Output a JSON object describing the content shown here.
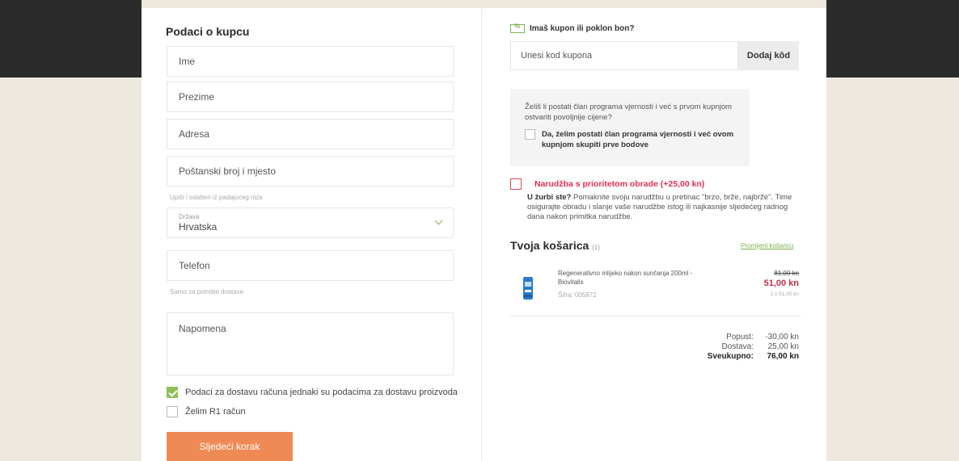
{
  "buyer": {
    "title": "Podaci o kupcu",
    "fields": {
      "first_name": "Ime",
      "last_name": "Prezime",
      "address": "Adresa",
      "postal": "Poštanski broj i mjesto",
      "postal_hint": "Upiši i odaberi iz padajućeg niza",
      "country_label": "Država",
      "country_value": "Hrvatska",
      "phone": "Telefon",
      "phone_hint": "Samo za potrebe dostave",
      "note": "Napomena"
    },
    "same_billing_label": "Podaci za dostavu računa jednaki su podacima za dostavu proizvoda",
    "same_billing_checked": true,
    "r1_label": "Želim R1 račun",
    "r1_checked": false,
    "next_button": "Sljedeći korak"
  },
  "coupon": {
    "heading": "Imaš kupon ili poklon bon?",
    "placeholder": "Unesi kod kupona",
    "button": "Dodaj kôd"
  },
  "loyalty": {
    "text": "Želiš li postati član programa vjernosti i već s prvom kupnjom ostvariti povoljnije cijene?",
    "checkbox_label": "Da, želim postati član programa vjernosti i već ovom kupnjom skupiti prve bodove"
  },
  "priority": {
    "label": "Narudžba s prioritetom obrade (+25,00 kn)",
    "desc_bold": "U žurbi ste?",
    "desc": " Pomaknite svoju narudžbu u pretinac \"brzo, brže, najbrže\". Time osigurajte obradu i slanje vaše narudžbe istog ili najkasnije sljedećeg radnog dana nakon primitka narudžbe."
  },
  "cart": {
    "title": "Tvoja košarica",
    "count": "(1)",
    "edit_link": "Promijeni košaricu",
    "item": {
      "name": "Regenerativno mlijeko nakon sunčanja 200ml - Biovitalis",
      "code": "Šifra: 005872",
      "old_price": "81,00 kn",
      "new_price": "51,00 kn",
      "qty": "1 x 51,00 kn"
    },
    "summary": {
      "discount_label": "Popust:",
      "discount_value": "-30,00 kn",
      "shipping_label": "Dostava:",
      "shipping_value": "25,00 kn",
      "total_label": "Sveukupno:",
      "total_value": "76,00 kn"
    }
  },
  "colors": {
    "accent_green": "#8fbf5a",
    "button_orange": "#f08a55",
    "price_red": "#c8324e"
  }
}
